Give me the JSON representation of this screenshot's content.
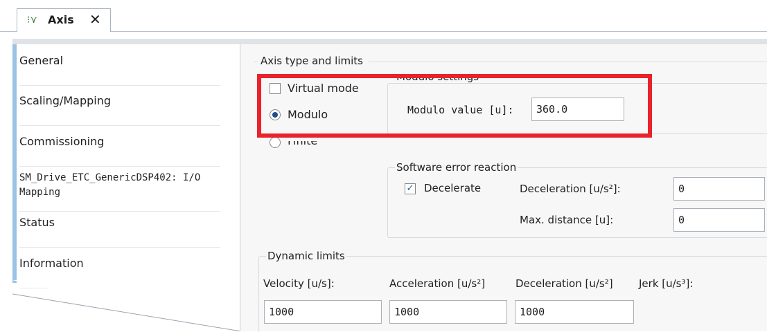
{
  "tab": {
    "title": "Axis",
    "icon": "axis-icon",
    "close": "✕"
  },
  "nav": {
    "items": [
      {
        "label": "General"
      },
      {
        "label": "Scaling/Mapping"
      },
      {
        "label": "Commissioning"
      },
      {
        "label": "SM_Drive_ETC_GenericDSP402: I/O",
        "label2": "Mapping"
      },
      {
        "label": "Status"
      },
      {
        "label": "Information"
      }
    ]
  },
  "axis_type": {
    "title": "Axis type and limits",
    "virtual_mode": {
      "label": "Virtual mode",
      "checked": false
    },
    "modulo": {
      "label": "Modulo",
      "selected": true
    },
    "finite": {
      "label": "Finite",
      "selected": false
    }
  },
  "modulo_settings": {
    "title": "Modulo settings",
    "value_label": "Modulo value [u]:",
    "value": "360.0"
  },
  "software_error": {
    "title": "Software error reaction",
    "decelerate": {
      "label": "Decelerate",
      "checked": true
    },
    "deceleration_label": "Deceleration [u/s²]:",
    "deceleration_value": "0",
    "max_distance_label": "Max. distance [u]:",
    "max_distance_value": "0"
  },
  "dynamic_limits": {
    "title": "Dynamic limits",
    "velocity_label": "Velocity [u/s]:",
    "acceleration_label": "Acceleration [u/s²]",
    "deceleration_label": "Deceleration [u/s²]",
    "jerk_label": "Jerk [u/s³]:",
    "velocity_value": "1000",
    "acceleration_value": "1000",
    "deceleration_value": "1000"
  },
  "colors": {
    "highlight": "#e8232c",
    "nav_accent": "#9cc3e6",
    "panel_bg": "#f7f7f7"
  }
}
